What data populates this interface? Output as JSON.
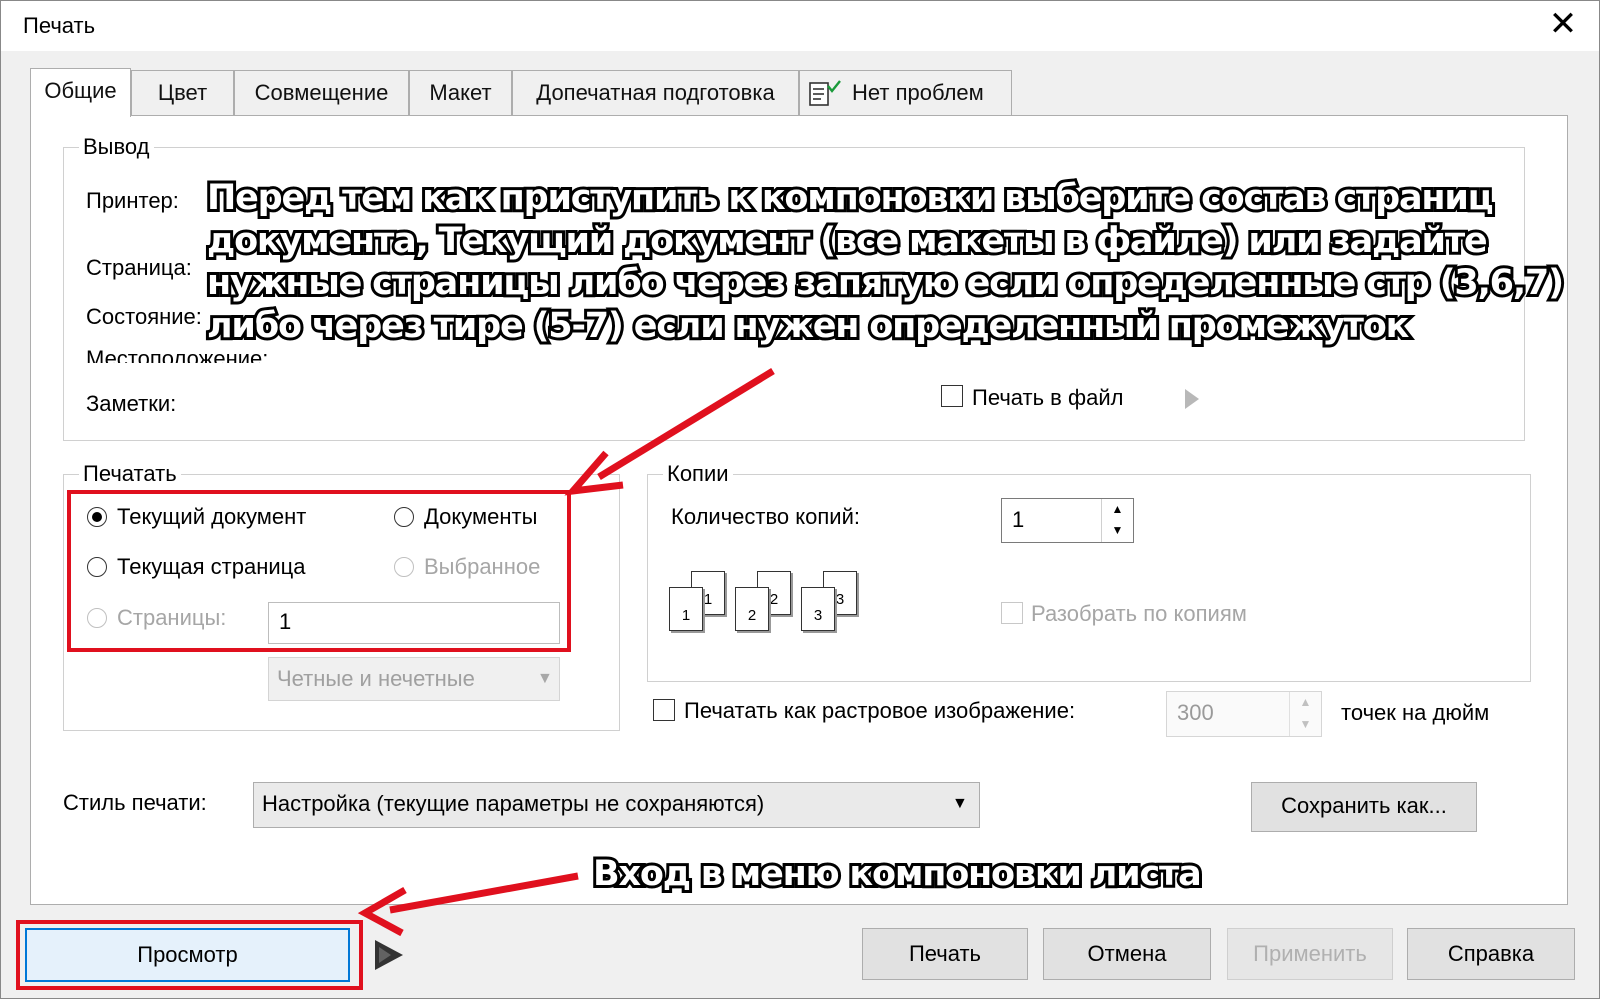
{
  "window": {
    "title": "Печать",
    "close_symbol": "✕"
  },
  "tabs": [
    {
      "label": "Общие"
    },
    {
      "label": "Цвет"
    },
    {
      "label": "Совмещение"
    },
    {
      "label": "Макет"
    },
    {
      "label": "Допечатная подготовка"
    },
    {
      "label": "Нет проблем",
      "icon": "checklist-icon"
    }
  ],
  "output": {
    "legend": "Вывод",
    "printer_label": "Принтер:",
    "page_label": "Страница:",
    "status_label": "Состояние:",
    "location_label": "Местоположение:",
    "notes_label": "Заметки:",
    "print_to_file": "Печать в файл",
    "print_to_file_checked": false
  },
  "print_range": {
    "legend": "Печатать",
    "current_document": "Текущий документ",
    "documents": "Документы",
    "current_page": "Текущая страница",
    "selection": "Выбранное",
    "pages": "Страницы:",
    "pages_value": "1",
    "even_odd": "Четные и нечетные",
    "selected_option": "current_document"
  },
  "copies": {
    "legend": "Копии",
    "count_label": "Количество копий:",
    "count_value": "1",
    "collate": "Разобрать по копиям",
    "collate_checked": false,
    "page_icon_numbers": [
      "1",
      "1",
      "2",
      "2",
      "3",
      "3"
    ]
  },
  "raster": {
    "label": "Печатать как растровое изображение:",
    "checked": false,
    "dpi_value": "300",
    "dpi_unit": "точек на дюйм"
  },
  "style": {
    "label": "Стиль печати:",
    "value": "Настройка (текущие параметры не сохраняются)",
    "save_as": "Сохранить как..."
  },
  "footer": {
    "preview": "Просмотр",
    "print": "Печать",
    "cancel": "Отмена",
    "apply": "Применить",
    "help": "Справка"
  },
  "annotations": {
    "top_lines": [
      "Перед тем как приступить к компоновки выберите состав страниц",
      "документа, Текущий документ (все макеты в файле) или задайте",
      "нужные страницы либо через запятую если определенные стр (3,6,7)",
      "либо через тире (5-7) если нужен определенный промежуток"
    ],
    "bottom": "Вход в меню компоновки листа",
    "highlight_color": "#e0101e"
  }
}
